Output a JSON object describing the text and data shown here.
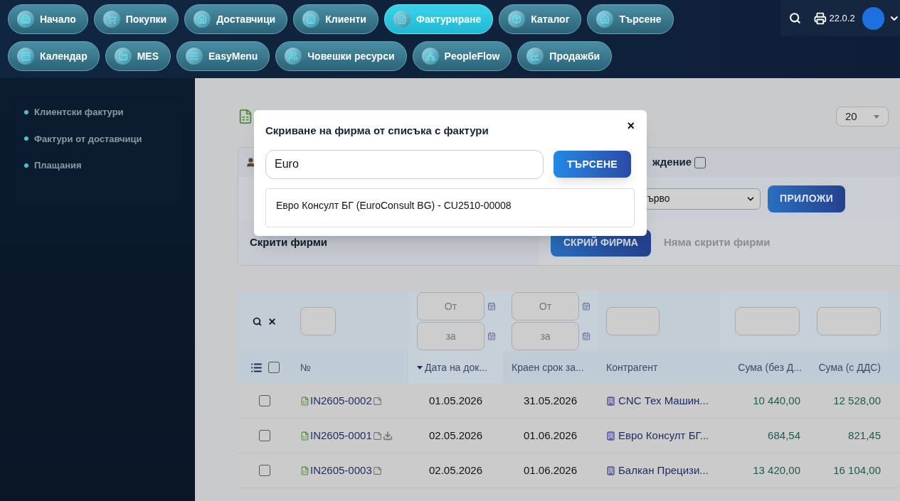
{
  "nav": {
    "rows": [
      [
        {
          "label": "Начало",
          "selected": false
        },
        {
          "label": "Покупки",
          "selected": false
        },
        {
          "label": "Доставчици",
          "selected": false
        },
        {
          "label": "Клиенти",
          "selected": false
        },
        {
          "label": "Фактуриране",
          "selected": true
        },
        {
          "label": "Каталог",
          "selected": false
        },
        {
          "label": "Търсене",
          "selected": false
        }
      ],
      [
        {
          "label": "Календар",
          "selected": false
        },
        {
          "label": "MES",
          "selected": false
        },
        {
          "label": "EasyMenu",
          "selected": false
        },
        {
          "label": "Човешки ресурси",
          "selected": false
        },
        {
          "label": "PeopleFlow",
          "selected": false
        },
        {
          "label": "Продажби",
          "selected": false
        }
      ]
    ],
    "version": "22.0.2"
  },
  "sidebar": {
    "items": [
      {
        "label": "Клиентски фактури"
      },
      {
        "label": "Фактури от доставчици"
      },
      {
        "label": "Плащания"
      }
    ]
  },
  "page_size": "20",
  "filters": {
    "row_1_text": "ждение",
    "row_1_checked": false,
    "row_2_select": "ърво",
    "apply_button": "ПРИЛОЖИ",
    "hidden_label": "Скрити фирми",
    "hide_button": "СКРИЙ ФИРМА",
    "hidden_empty": "Няма скрити фирми"
  },
  "table": {
    "select_all_checked": false,
    "date_filters": [
      {
        "from_placeholder": "От",
        "to_placeholder": "за"
      },
      {
        "from_placeholder": "От",
        "to_placeholder": "за"
      }
    ],
    "columns": [
      {
        "label": "№",
        "sorted": false
      },
      {
        "label": "Дата на док...",
        "sorted": true
      },
      {
        "label": "Краен срок за...",
        "sorted": false
      },
      {
        "label": "Контрагент",
        "sorted": false
      },
      {
        "label": "Сума (без Д...",
        "sorted": false
      },
      {
        "label": "Сума (с ДДС)",
        "sorted": false
      }
    ],
    "rows": [
      {
        "checked": false,
        "number": "IN2605-0002",
        "download": false,
        "date": "01.05.2026",
        "deadline": "31.05.2026",
        "counterparty": "CNC Тех Машин...",
        "net": "10 440,00",
        "gross": "12 528,00"
      },
      {
        "checked": false,
        "number": "IN2605-0001",
        "download": true,
        "date": "02.05.2026",
        "deadline": "01.06.2026",
        "counterparty": "Евро Консулт БГ...",
        "net": "684,54",
        "gross": "821,45"
      },
      {
        "checked": false,
        "number": "IN2605-0003",
        "download": false,
        "date": "02.05.2026",
        "deadline": "01.06.2026",
        "counterparty": "Балкан Прецизи...",
        "net": "13 420,00",
        "gross": "16 104,00"
      }
    ]
  },
  "modal": {
    "title": "Скриване на фирма от списъка с фактури",
    "close": "×",
    "search_value": "Euro",
    "search_button": "ТЪРСЕНЕ",
    "results": [
      "Евро Консулт БГ (EuroConsult BG) - CU2510-00008"
    ]
  }
}
